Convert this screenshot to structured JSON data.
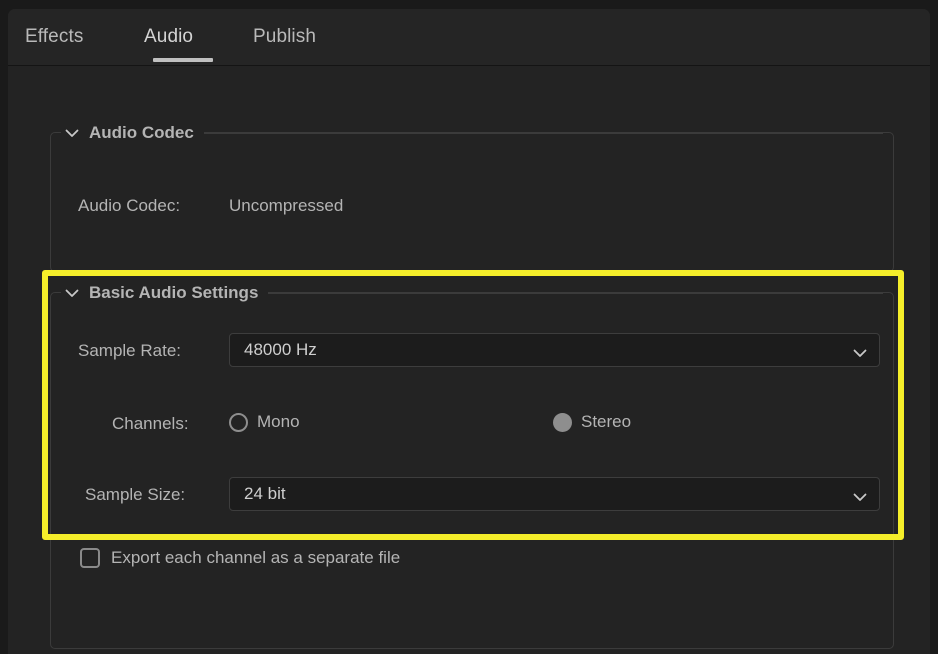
{
  "tabs": [
    {
      "label": "Effects",
      "active": false
    },
    {
      "label": "Audio",
      "active": true
    },
    {
      "label": "Publish",
      "active": false
    }
  ],
  "groups": {
    "audio_codec": {
      "title": "Audio Codec",
      "collapse_icon": "chevron-down-icon",
      "rows": {
        "codec": {
          "label": "Audio Codec:",
          "value": "Uncompressed"
        }
      }
    },
    "basic_audio": {
      "title": "Basic Audio Settings",
      "collapse_icon": "chevron-down-icon",
      "rows": {
        "sample_rate": {
          "label": "Sample Rate:",
          "value": "48000 Hz",
          "chevron_icon": "chevron-down-icon"
        },
        "channels": {
          "label": "Channels:",
          "options": [
            {
              "label": "Mono",
              "selected": false
            },
            {
              "label": "Stereo",
              "selected": true
            }
          ]
        },
        "sample_size": {
          "label": "Sample Size:",
          "value": "24 bit",
          "chevron_icon": "chevron-down-icon"
        },
        "export_each_channel": {
          "label": "Export each channel as a separate file",
          "checked": false
        }
      }
    }
  },
  "highlight": {
    "color": "#f5ee2a",
    "target": "basic-audio-settings"
  },
  "colors": {
    "background": "#232323",
    "tabbar": "#252525",
    "field": "#1c1c1c",
    "border": "#3b3b3b",
    "text": "#b4b4b4",
    "accent_underline": "#c0c0c0",
    "highlight": "#f5ee2a"
  }
}
